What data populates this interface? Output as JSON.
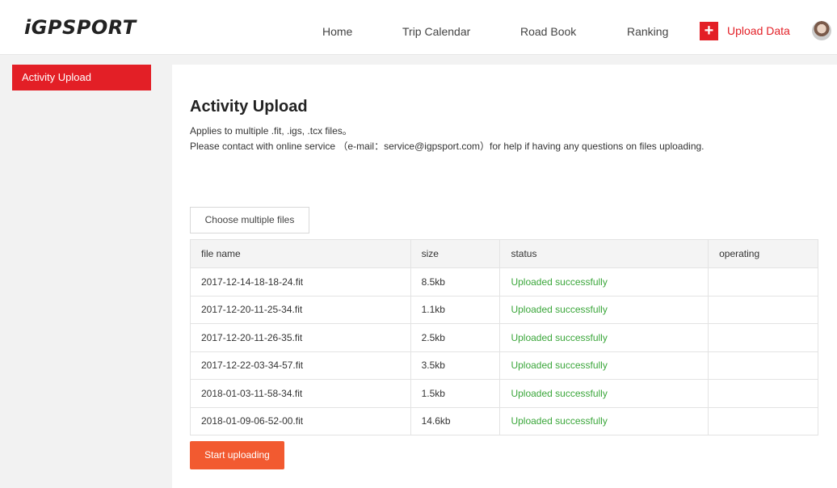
{
  "header": {
    "logo": "iGPSPORT",
    "nav": [
      "Home",
      "Trip Calendar",
      "Road Book",
      "Ranking"
    ],
    "upload_label": "Upload Data",
    "upload_icon": "+"
  },
  "sidebar": {
    "items": [
      {
        "label": "Activity Upload"
      }
    ]
  },
  "main": {
    "title": "Activity Upload",
    "desc_line1": "Applies to multiple .fit, .igs, .tcx files。",
    "desc_line2": "Please contact with online service （e-mail：service@igpsport.com）for help if having any questions on files uploading.",
    "choose_label": "Choose multiple files",
    "table": {
      "headers": [
        "file name",
        "size",
        "status",
        "operating"
      ],
      "rows": [
        [
          "2017-12-14-18-18-24.fit",
          "8.5kb",
          "Uploaded successfully",
          ""
        ],
        [
          "2017-12-20-11-25-34.fit",
          "1.1kb",
          "Uploaded successfully",
          ""
        ],
        [
          "2017-12-20-11-26-35.fit",
          "2.5kb",
          "Uploaded successfully",
          ""
        ],
        [
          "2017-12-22-03-34-57.fit",
          "3.5kb",
          "Uploaded successfully",
          ""
        ],
        [
          "2018-01-03-11-58-34.fit",
          "1.5kb",
          "Uploaded successfully",
          ""
        ],
        [
          "2018-01-09-06-52-00.fit",
          "14.6kb",
          "Uploaded successfully",
          ""
        ]
      ]
    },
    "start_label": "Start uploading"
  },
  "colors": {
    "brand_red": "#e31f26",
    "success_green": "#3aa63a",
    "start_orange": "#f25a30"
  }
}
